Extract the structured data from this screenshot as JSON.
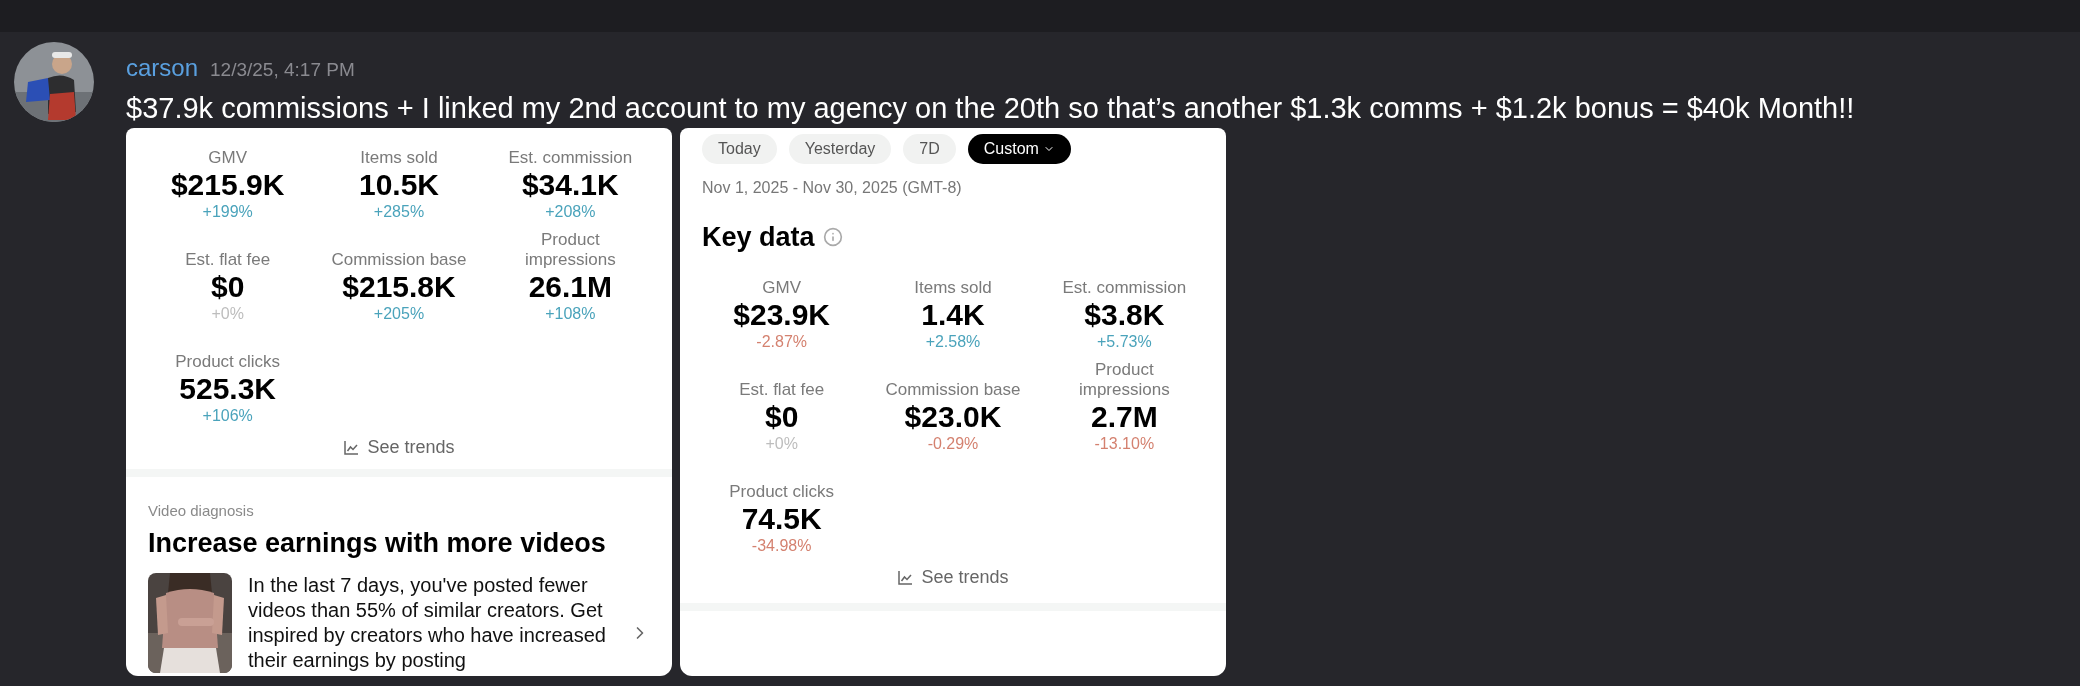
{
  "message": {
    "author": "carson",
    "timestamp": "12/3/25, 4:17 PM",
    "text": "$37.9k commissions + I linked my 2nd account to my agency on the 20th so that’s another $1.3k comms + $1.2k bonus = $40k Month!!"
  },
  "attachments": [
    {
      "kind": "overview",
      "metrics": [
        {
          "label": "GMV",
          "value": "$215.9K",
          "change": "+199%",
          "color": "#4aa3bb"
        },
        {
          "label": "Items sold",
          "value": "10.5K",
          "change": "+285%",
          "color": "#4aa3bb"
        },
        {
          "label": "Est. commission",
          "value": "$34.1K",
          "change": "+208%",
          "color": "#4aa3bb"
        },
        {
          "label": "Est. flat fee",
          "value": "$0",
          "change": "+0%",
          "color": "#bdbdbd"
        },
        {
          "label": "Commission base",
          "value": "$215.8K",
          "change": "+205%",
          "color": "#4aa3bb"
        },
        {
          "label": "Product impressions",
          "value": "26.1M",
          "change": "+108%",
          "color": "#4aa3bb"
        },
        {
          "label": "Product clicks",
          "value": "525.3K",
          "change": "+106%",
          "color": "#4aa3bb"
        }
      ],
      "see_trends": "See trends",
      "video_diagnosis": {
        "section_label": "Video diagnosis",
        "title": "Increase earnings with more videos",
        "body": "In the last 7 days, you've posted fewer videos than 55% of similar creators. Get inspired by creators who have increased their earnings by posting"
      }
    },
    {
      "kind": "key_data",
      "range_chips": [
        {
          "label": "Today",
          "selected": false
        },
        {
          "label": "Yesterday",
          "selected": false
        },
        {
          "label": "7D",
          "selected": false
        },
        {
          "label": "Custom",
          "selected": true
        }
      ],
      "date_range": "Nov 1, 2025 - Nov 30, 2025 (GMT-8)",
      "title": "Key data",
      "metrics": [
        {
          "label": "GMV",
          "value": "$23.9K",
          "change": "-2.87%",
          "color": "#d4816f"
        },
        {
          "label": "Items sold",
          "value": "1.4K",
          "change": "+2.58%",
          "color": "#4aa3bb"
        },
        {
          "label": "Est. commission",
          "value": "$3.8K",
          "change": "+5.73%",
          "color": "#4aa3bb"
        },
        {
          "label": "Est. flat fee",
          "value": "$0",
          "change": "+0%",
          "color": "#bdbdbd"
        },
        {
          "label": "Commission base",
          "value": "$23.0K",
          "change": "-0.29%",
          "color": "#d4816f"
        },
        {
          "label": "Product impressions",
          "value": "2.7M",
          "change": "-13.10%",
          "color": "#d4816f"
        },
        {
          "label": "Product clicks",
          "value": "74.5K",
          "change": "-34.98%",
          "color": "#d4816f"
        }
      ],
      "see_trends": "See trends"
    }
  ]
}
